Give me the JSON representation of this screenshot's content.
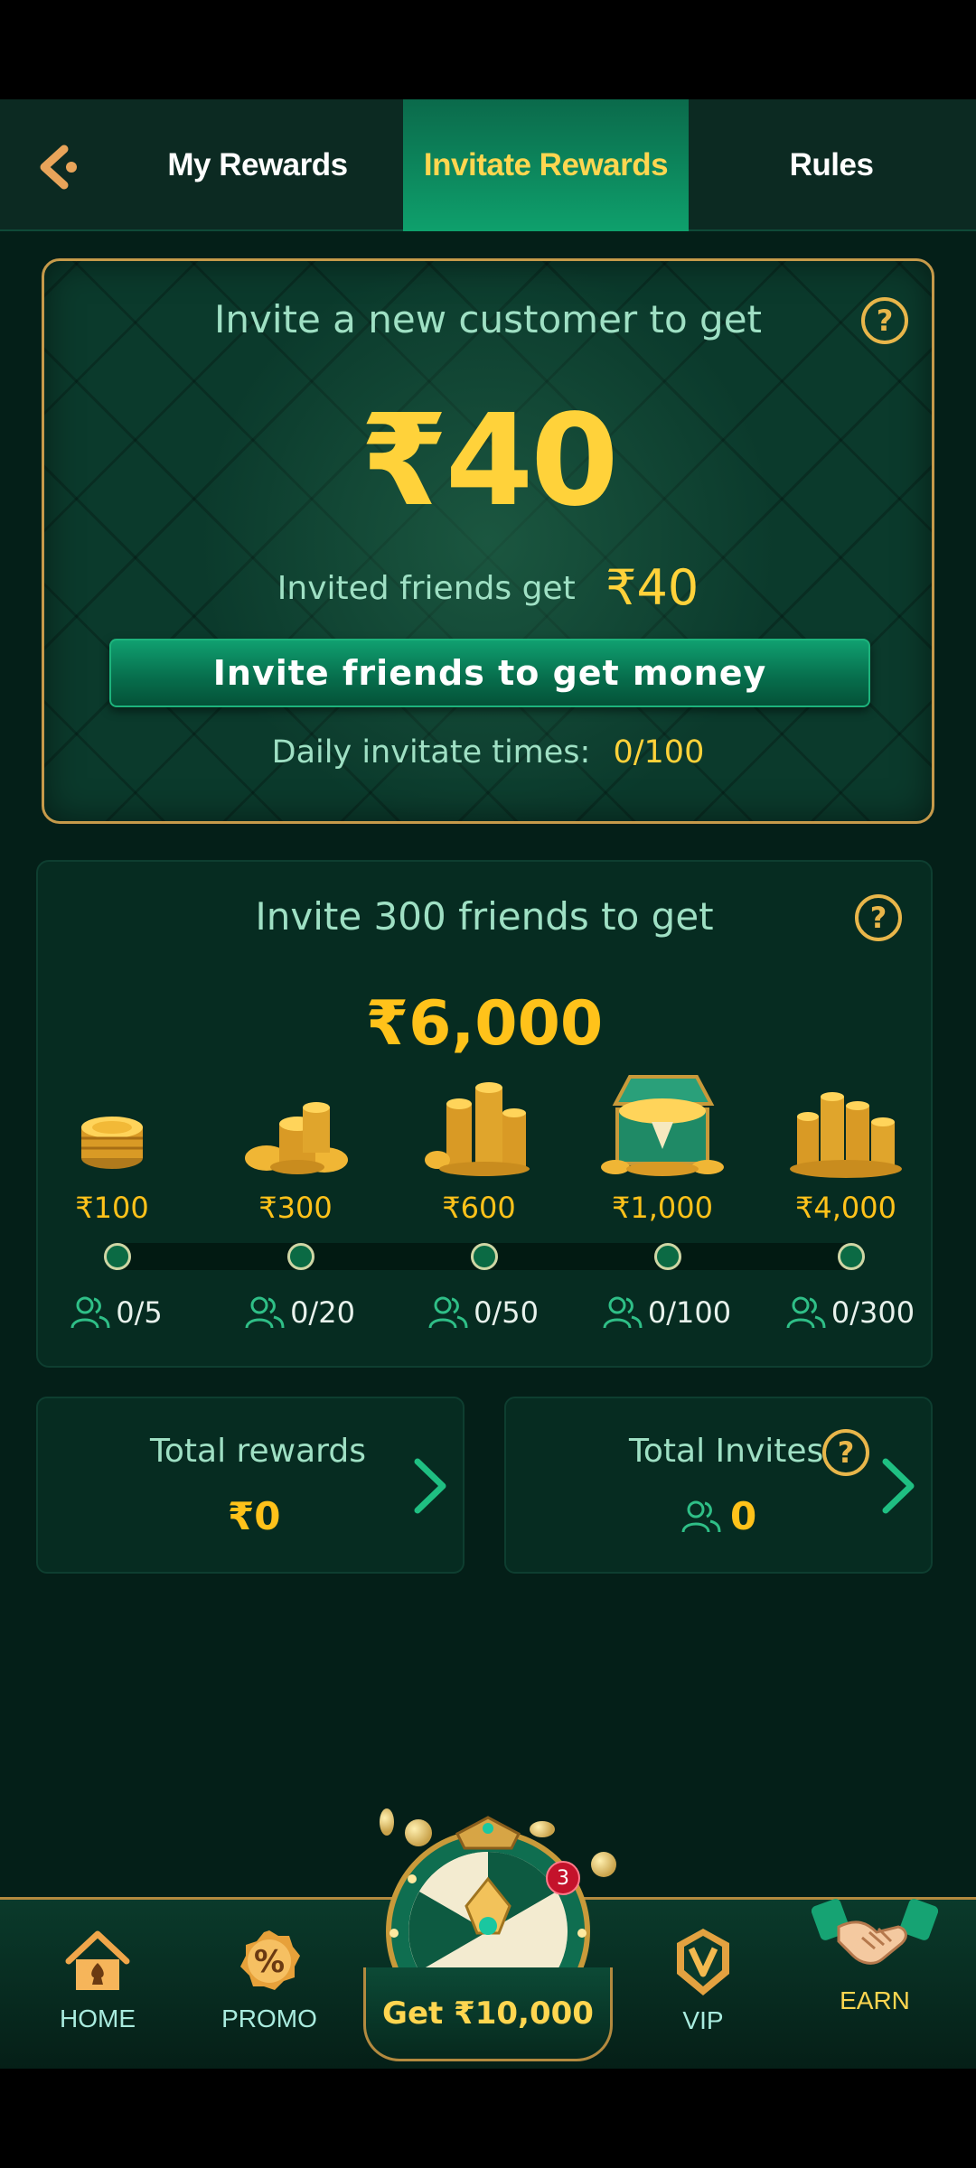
{
  "tabs": {
    "my_rewards": "My Rewards",
    "invite_rewards": "Invitate Rewards",
    "rules": "Rules"
  },
  "invite_card": {
    "title": "Invite a new customer to get",
    "amount": "₹40",
    "friends_get_label": "Invited friends get",
    "friends_get_amount": "₹40",
    "button_label": "Invite friends to get money",
    "daily_label": "Daily invitate times:",
    "daily_value": "0/100"
  },
  "milestone_card": {
    "title": "Invite 300 friends to get",
    "amount": "₹6,000",
    "tiers": [
      {
        "reward": "₹100",
        "progress": "0/5",
        "icon": "coin-stack-small-icon"
      },
      {
        "reward": "₹300",
        "progress": "0/20",
        "icon": "coin-pile-icon"
      },
      {
        "reward": "₹600",
        "progress": "0/50",
        "icon": "coin-towers-icon"
      },
      {
        "reward": "₹1,000",
        "progress": "0/100",
        "icon": "treasure-chest-icon"
      },
      {
        "reward": "₹4,000",
        "progress": "0/300",
        "icon": "coin-mountain-icon"
      }
    ]
  },
  "stats": {
    "total_rewards_label": "Total rewards",
    "total_rewards_value": "₹0",
    "total_invites_label": "Total Invites",
    "total_invites_value": "0"
  },
  "bottom_nav": {
    "home": "HOME",
    "promo": "PROMO",
    "center_button": "Get ₹10,000",
    "wheel_badge": "3",
    "vip": "VIP",
    "earn": "EARN"
  },
  "colors": {
    "background": "#041f18",
    "accent_green": "#0ea06c",
    "gold": "#ffd23a",
    "text_mint": "#9fe0c4"
  }
}
